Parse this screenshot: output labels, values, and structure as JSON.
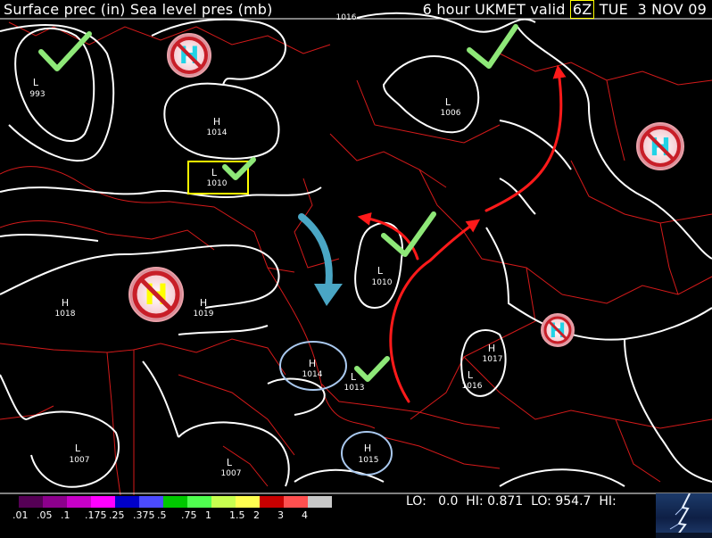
{
  "header": {
    "left_title": "Surface prec (in) Sea level pres (mb)",
    "right_prefix": "6 hour UKMET valid ",
    "valid_time": "6Z",
    "right_suffix": " TUE  3 NOV 09"
  },
  "pressure_labels": [
    {
      "type": "L",
      "value": "993"
    },
    {
      "type": "H",
      "value": "1014"
    },
    {
      "type": "L",
      "value": "1010"
    },
    {
      "type": "L",
      "value": "1006"
    },
    {
      "type": "L",
      "value": "1010"
    },
    {
      "type": "H",
      "value": "1018"
    },
    {
      "type": "H",
      "value": "1019"
    },
    {
      "type": "H",
      "value": "1014"
    },
    {
      "type": "L",
      "value": "1013"
    },
    {
      "type": "H",
      "value": "1017"
    },
    {
      "type": "L",
      "value": "1016"
    },
    {
      "type": "H",
      "value": "1015"
    },
    {
      "type": "L",
      "value": "1007"
    },
    {
      "type": "L",
      "value": "1007"
    },
    {
      "type": "",
      "value": "1016"
    }
  ],
  "no_high_symbols": [
    {
      "letter": "H",
      "letter_color": "#22d3e6"
    },
    {
      "letter": "H",
      "letter_color": "#ffff00"
    },
    {
      "letter": "H",
      "letter_color": "#22d3e6"
    },
    {
      "letter": "H",
      "letter_color": "#22d3e6"
    }
  ],
  "colors": {
    "isobar": "#ffffff",
    "borders": "#d41a1a",
    "flow_arrow": "#ff1a1a",
    "teal_arrow": "#4aa6c4",
    "check_mark": "#8ee878",
    "ellipse": "#a9c8ee",
    "highlight_box": "#ffff00",
    "no_symbol_ring": "#c81e28"
  },
  "legend": {
    "colors": [
      "#550055",
      "#8c008c",
      "#c800c8",
      "#ff00ff",
      "#0000c8",
      "#4b4bff",
      "#00c800",
      "#50ff50",
      "#c8ff50",
      "#ffff50",
      "#c80000",
      "#ff5050",
      "#c8c8c8"
    ],
    "labels": [
      ".01",
      ".05",
      ".1",
      ".175",
      ".25",
      ".375",
      ".5",
      ".75",
      "1",
      "1.5",
      "2",
      "3",
      "4"
    ],
    "stats": "LO:   0.0  HI: 0.871  LO: 954.7  HI:"
  }
}
